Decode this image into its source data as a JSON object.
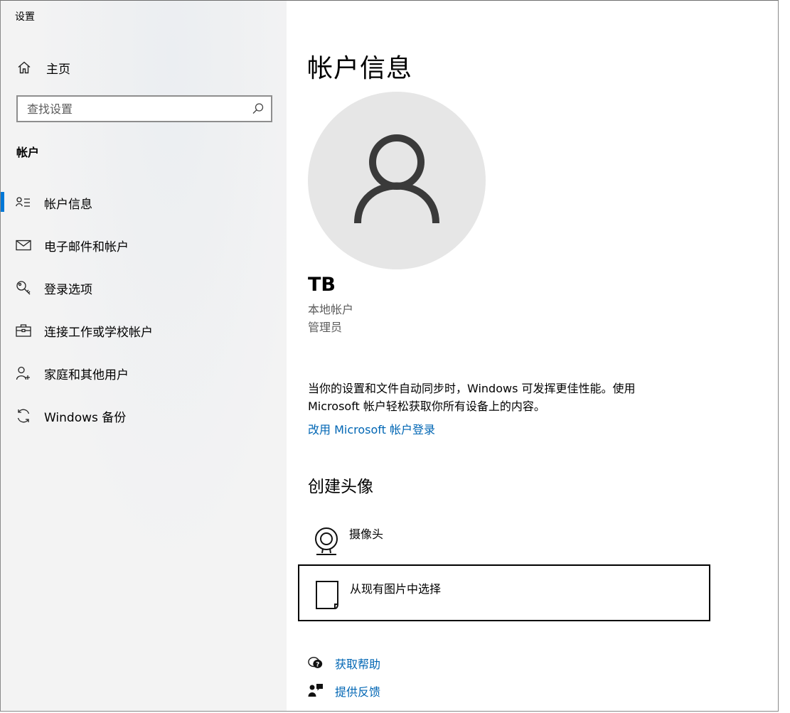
{
  "window": {
    "title": "设置"
  },
  "sidebar": {
    "home_label": "主页",
    "search": {
      "placeholder": "查找设置",
      "value": ""
    },
    "section_label": "帐户",
    "items": [
      {
        "label": "帐户信息",
        "icon": "account-info-icon",
        "selected": true
      },
      {
        "label": "电子邮件和帐户",
        "icon": "mail-icon",
        "selected": false
      },
      {
        "label": "登录选项",
        "icon": "key-icon",
        "selected": false
      },
      {
        "label": "连接工作或学校帐户",
        "icon": "briefcase-icon",
        "selected": false
      },
      {
        "label": "家庭和其他用户",
        "icon": "add-user-icon",
        "selected": false
      },
      {
        "label": "Windows 备份",
        "icon": "sync-icon",
        "selected": false
      }
    ]
  },
  "main": {
    "title": "帐户信息",
    "user": {
      "name": "TB",
      "account_type": "本地帐户",
      "role": "管理员"
    },
    "sync_message": "当你的设置和文件自动同步时，Windows 可发挥更佳性能。使用 Microsoft 帐户轻松获取你所有设备上的内容。",
    "ms_signin_link": "改用 Microsoft 帐户登录",
    "create_avatar": {
      "title": "创建头像",
      "options": [
        {
          "label": "摄像头",
          "icon": "camera-icon"
        },
        {
          "label": "从现有图片中选择",
          "icon": "document-icon"
        }
      ]
    },
    "links": {
      "help": "获取帮助",
      "feedback": "提供反馈"
    }
  },
  "colors": {
    "accent": "#0078d7",
    "link": "#0066b4",
    "sidebar_bg": "#f3f3f3",
    "avatar_bg": "#e6e6e6"
  }
}
